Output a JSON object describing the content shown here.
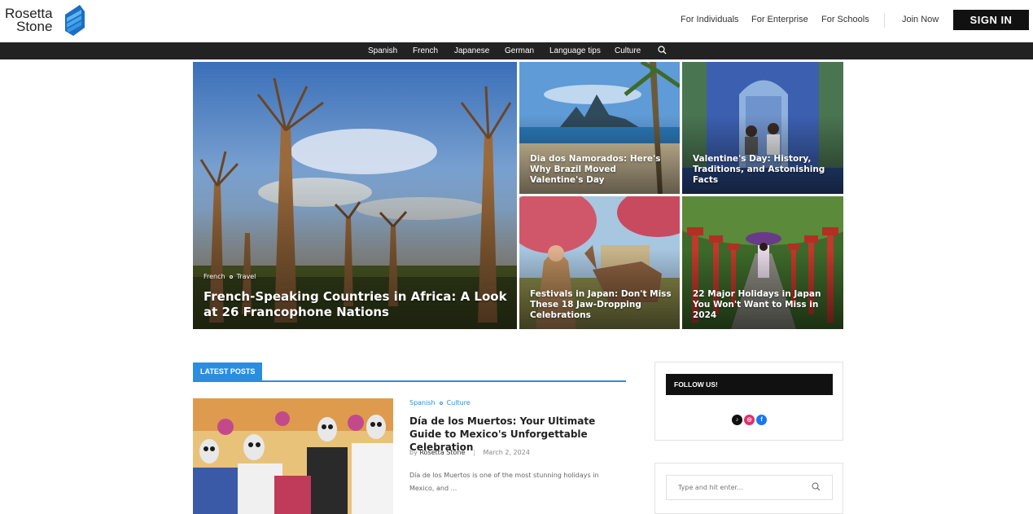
{
  "header": {
    "logo_line1": "Rosetta",
    "logo_line2": "Stone",
    "nav": [
      "For Individuals",
      "For Enterprise",
      "For Schools"
    ],
    "join": "Join Now",
    "signin": "SIGN IN"
  },
  "topics": [
    "Spanish",
    "French",
    "Japanese",
    "German",
    "Language tips",
    "Culture"
  ],
  "hero": {
    "main": {
      "cat1": "French",
      "cat2": "Travel",
      "title": "French-Speaking Countries in Africa: A Look at 26 Francophone Nations"
    },
    "tiles": [
      {
        "title": "Dia dos Namorados: Here's Why Brazil Moved Valentine's Day"
      },
      {
        "title": "Valentine's Day: History, Traditions, and Astonishing Facts"
      },
      {
        "title": "Festivals in Japan: Don't Miss These 18 Jaw-Dropping Celebrations"
      },
      {
        "title": "22 Major Holidays in Japan You Won't Want to Miss in 2024"
      }
    ]
  },
  "latest": {
    "label": "LATEST POSTS",
    "post": {
      "cat1": "Spanish",
      "cat2": "Culture",
      "title": "Día de los Muertos: Your Ultimate Guide to Mexico's Unforgettable Celebration",
      "by": "by",
      "author": "Rosetta Stone",
      "date": "March 2, 2024",
      "excerpt": "Día de los Muertos is one of the most stunning holidays in Mexico, and ..."
    }
  },
  "sidebar": {
    "follow_title": "FOLLOW US!",
    "socials": [
      "tiktok-icon",
      "instagram-icon",
      "facebook-icon"
    ],
    "search_placeholder": "Type and hit enter..."
  },
  "colors": {
    "accent": "#2a8de0",
    "dark": "#222222",
    "signin": "#111111"
  }
}
